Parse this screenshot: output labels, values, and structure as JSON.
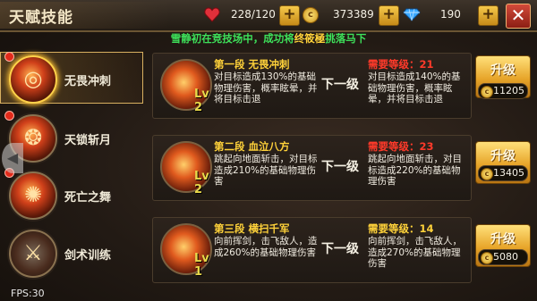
{
  "header": {
    "title": "天赋技能",
    "hp": "228/120",
    "gold": "373389",
    "diamond": "190",
    "heart_color": "#e0303a",
    "gold_color": "#e8b030",
    "diamond_color": "#3aa8ff"
  },
  "notice": {
    "prefix": "雪静初在竞技场中，成功将",
    "highlight": "终筱極",
    "suffix": "挑落马下"
  },
  "sidebar": {
    "items": [
      {
        "label": "无畏冲刺",
        "selected": true,
        "icon": "fire-swirl-icon",
        "has_dot": true
      },
      {
        "label": "天锁斩月",
        "selected": false,
        "icon": "fire-chain-icon",
        "has_dot": true
      },
      {
        "label": "死亡之舞",
        "selected": false,
        "icon": "fire-dance-icon",
        "has_dot": true
      },
      {
        "label": "剑术训练",
        "selected": false,
        "icon": "sword-icon",
        "has_dot": false
      }
    ]
  },
  "fps": "FPS:30",
  "stages": [
    {
      "title": "第一段 无畏冲刺",
      "level": "Lv 2",
      "desc": "对目标造成130%的基础物理伤害，概率眩晕，并将目标击退",
      "next_label": "下一级",
      "req_label": "需要等级：21",
      "req_color": "red",
      "next_desc": "对目标造成140%的基础物理伤害，概率眩晕，并将目标击退",
      "upgrade_label": "升级",
      "cost": "11205"
    },
    {
      "title": "第二段 血泣八方",
      "level": "Lv 2",
      "desc": "跳起向地面斩击，对目标造成210%的基础物理伤害",
      "next_label": "下一级",
      "req_label": "需要等级：23",
      "req_color": "red",
      "next_desc": "跳起向地面斩击，对目标造成220%的基础物理伤害",
      "upgrade_label": "升级",
      "cost": "13405"
    },
    {
      "title": "第三段 横扫千军",
      "level": "Lv 1",
      "desc": "向前挥剑，击飞敌人，造成260%的基础物理伤害",
      "next_label": "下一级",
      "req_label": "需要等级：14",
      "req_color": "yellow",
      "next_desc": "向前挥剑，击飞敌人，造成270%的基础物理伤害",
      "upgrade_label": "升级",
      "cost": "5080"
    }
  ]
}
